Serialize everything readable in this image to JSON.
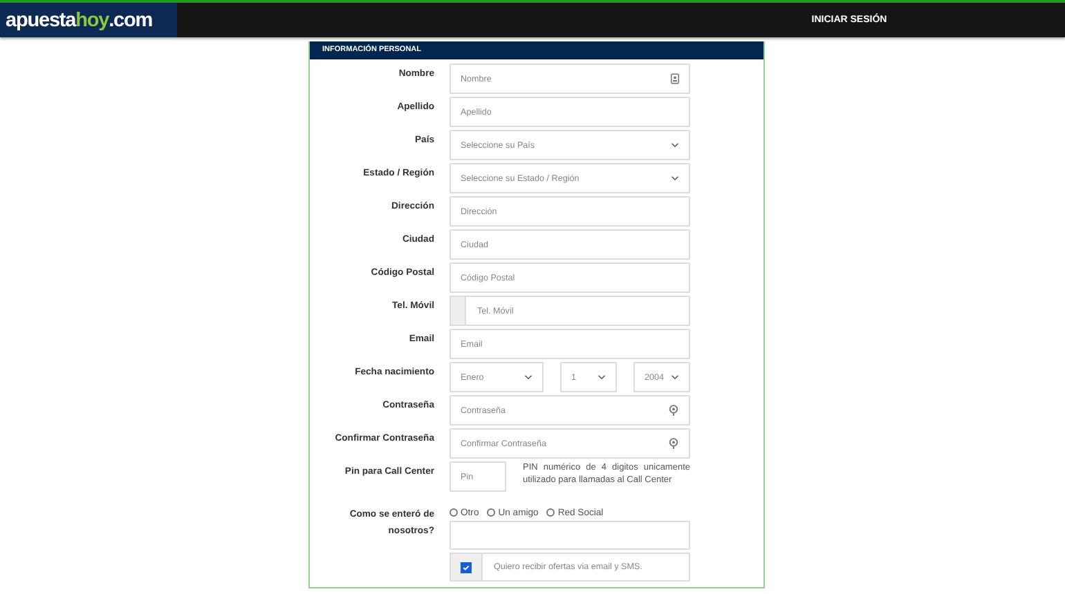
{
  "header": {
    "logo": {
      "first": "apuesta",
      "accent": "hoy",
      "suffix": ".com"
    },
    "login": "INICIAR SESIÓN"
  },
  "panel": {
    "title": "INFORMACIÓN PERSONAL",
    "fields": [
      {
        "kind": "name",
        "label": "Nombre",
        "placeholder": "Nombre"
      },
      {
        "kind": "text",
        "label": "Apellido",
        "placeholder": "Apellido"
      },
      {
        "kind": "select",
        "label": "País",
        "value": "Seleccione su País"
      },
      {
        "kind": "select",
        "label": "Estado / Región",
        "value": "Seleccione su Estado / Región"
      },
      {
        "kind": "text",
        "label": "Dirección",
        "placeholder": "Dirección"
      },
      {
        "kind": "text",
        "label": "Ciudad",
        "placeholder": "Ciudad"
      },
      {
        "kind": "text",
        "label": "Código Postal",
        "placeholder": "Código Postal"
      },
      {
        "kind": "phone",
        "label": "Tel. Móvil",
        "placeholder": "Tel. Móvil"
      },
      {
        "kind": "text",
        "label": "Email",
        "placeholder": "Email"
      },
      {
        "kind": "date",
        "label": "Fecha nacimiento",
        "selects": [
          "Enero",
          "1",
          "2004"
        ]
      },
      {
        "kind": "password",
        "label": "Contraseña",
        "placeholder": "Contraseña"
      },
      {
        "kind": "password",
        "label": "Confirmar Contraseña",
        "placeholder": "Confirmar Contraseña"
      },
      {
        "kind": "pin",
        "label": "Pin para Call Center",
        "placeholder": "Pin",
        "help": "PIN numérico de 4 digitos unicamente utilizado para llamadas al Call Center"
      },
      {
        "kind": "source",
        "label": "Como se enteró de nosotros?",
        "options": [
          {
            "label": "Otro",
            "selected": false
          },
          {
            "label": "Un amigo",
            "selected": false
          },
          {
            "label": "Red Social",
            "selected": false
          }
        ]
      },
      {
        "kind": "checkbox",
        "label": "Quiero recibir ofertas via email y SMS.",
        "checked": true
      }
    ]
  }
}
